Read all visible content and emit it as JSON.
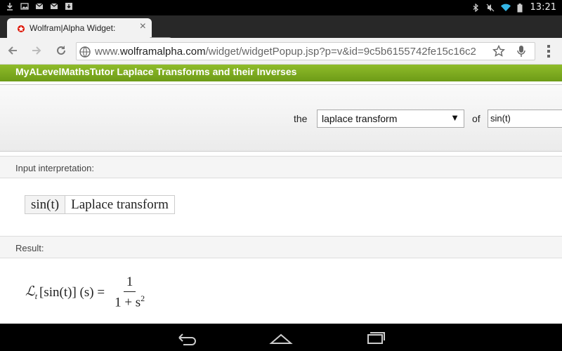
{
  "status_bar": {
    "clock": "13:21",
    "left_icons": [
      "download-icon",
      "image-icon",
      "gmail-icon",
      "gmail-icon",
      "download-box-icon"
    ],
    "right_icons": [
      "bluetooth-icon",
      "mute-icon",
      "wifi-icon",
      "battery-icon"
    ]
  },
  "browser": {
    "tab": {
      "title": "Wolfram|Alpha Widget:",
      "close": "×"
    },
    "url_domain_prefix": "www.",
    "url_domain": "wolframalpha.com",
    "url_path": "/widget/widgetPopup.jsp?p=v&id=9c5b6155742fe15c16c2"
  },
  "widget": {
    "title": "MyALevelMathsTutor Laplace Transforms and their Inverses",
    "form": {
      "label_the": "the",
      "select_value": "laplace transform",
      "select_arrow": "▼",
      "label_of": "of",
      "input_value": "sin(t)"
    },
    "pods": {
      "input_title": "Input interpretation:",
      "input_cells": [
        "sin(t)",
        "Laplace transform"
      ],
      "result_title": "Result:",
      "result_lhs_script": "ℒ",
      "result_lhs_sub": "t",
      "result_lhs_rest": "[sin(t)] (s) =",
      "result_num": "1",
      "result_den": "1 + s",
      "result_den_exp": "2"
    }
  },
  "colors": {
    "header_green": "#7aa820",
    "status_bar": "#000000",
    "tab_strip": "#282828"
  }
}
